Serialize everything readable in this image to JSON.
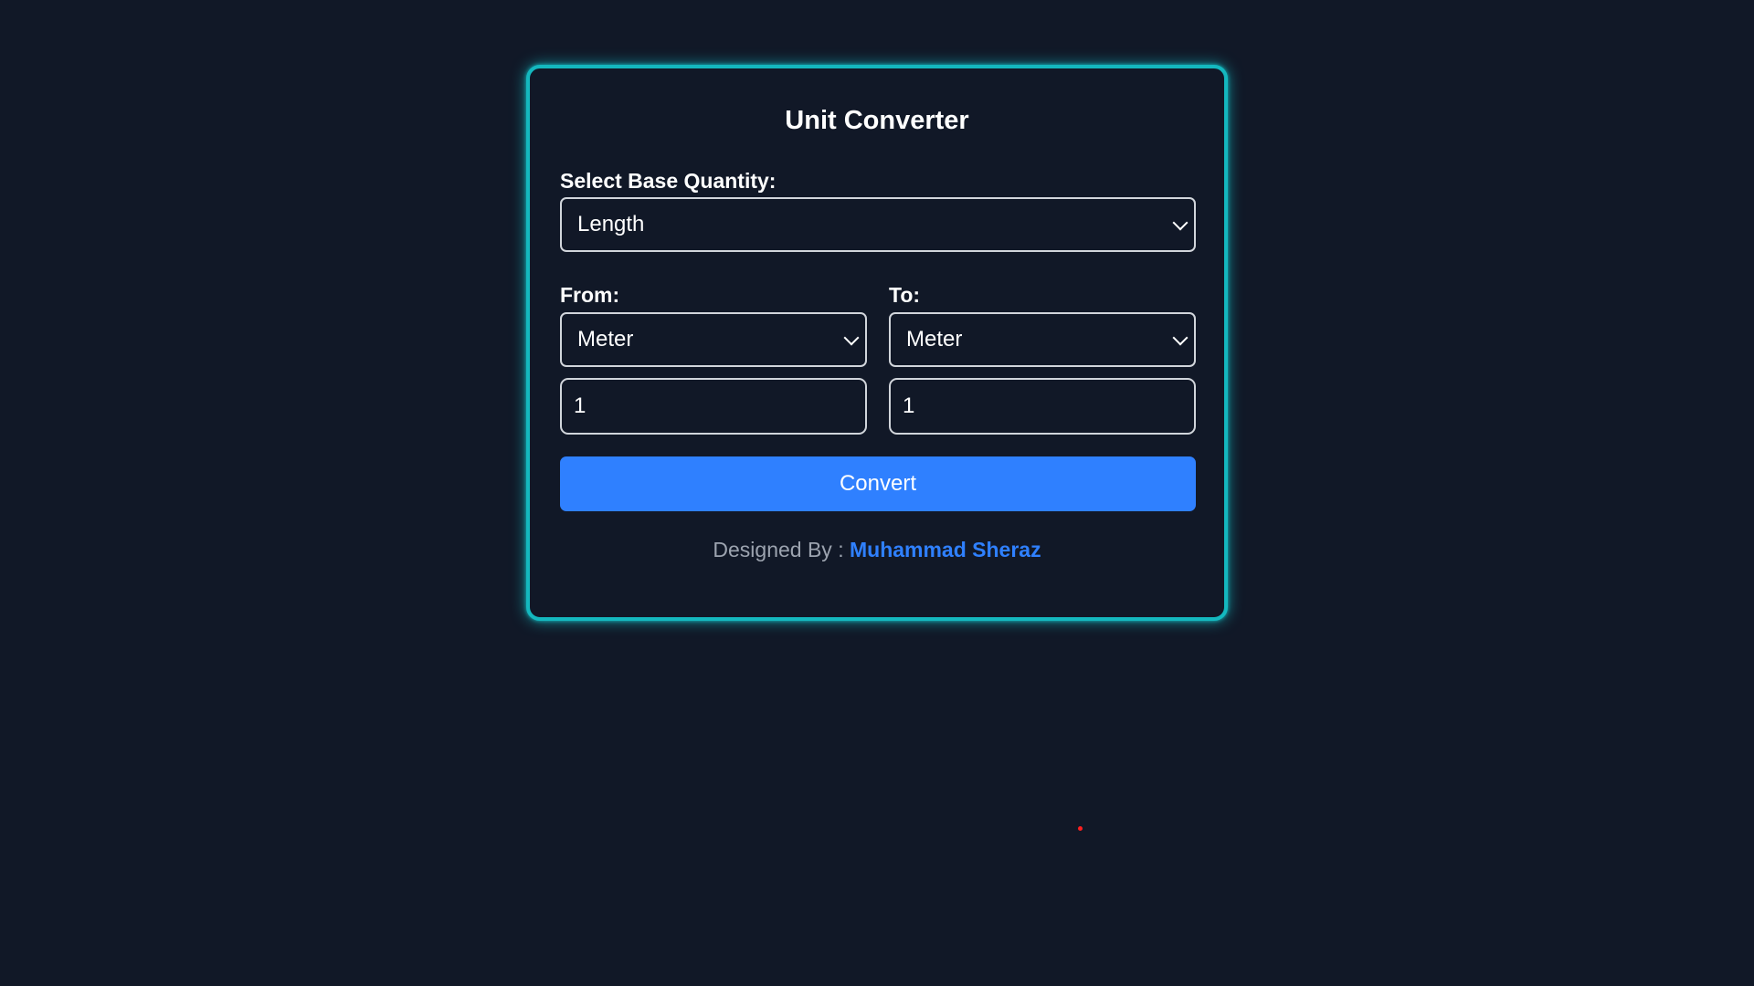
{
  "app": {
    "title": "Unit Converter"
  },
  "converter": {
    "base_label": "Select Base Quantity:",
    "base_value": "Length",
    "from_label": "From:",
    "to_label": "To:",
    "from_unit": "Meter",
    "to_unit": "Meter",
    "from_value": "1",
    "to_value": "1",
    "button_label": "Convert"
  },
  "footer": {
    "designed_by": "Designed By :",
    "author": "Muhammad Sheraz"
  },
  "colors": {
    "background": "#111827",
    "card_border": "#14b8bf",
    "accent": "#2f80ff",
    "cursor_dot": "#ff1f1f"
  },
  "icons": {
    "select_arrow": "chevron-down-icon"
  }
}
